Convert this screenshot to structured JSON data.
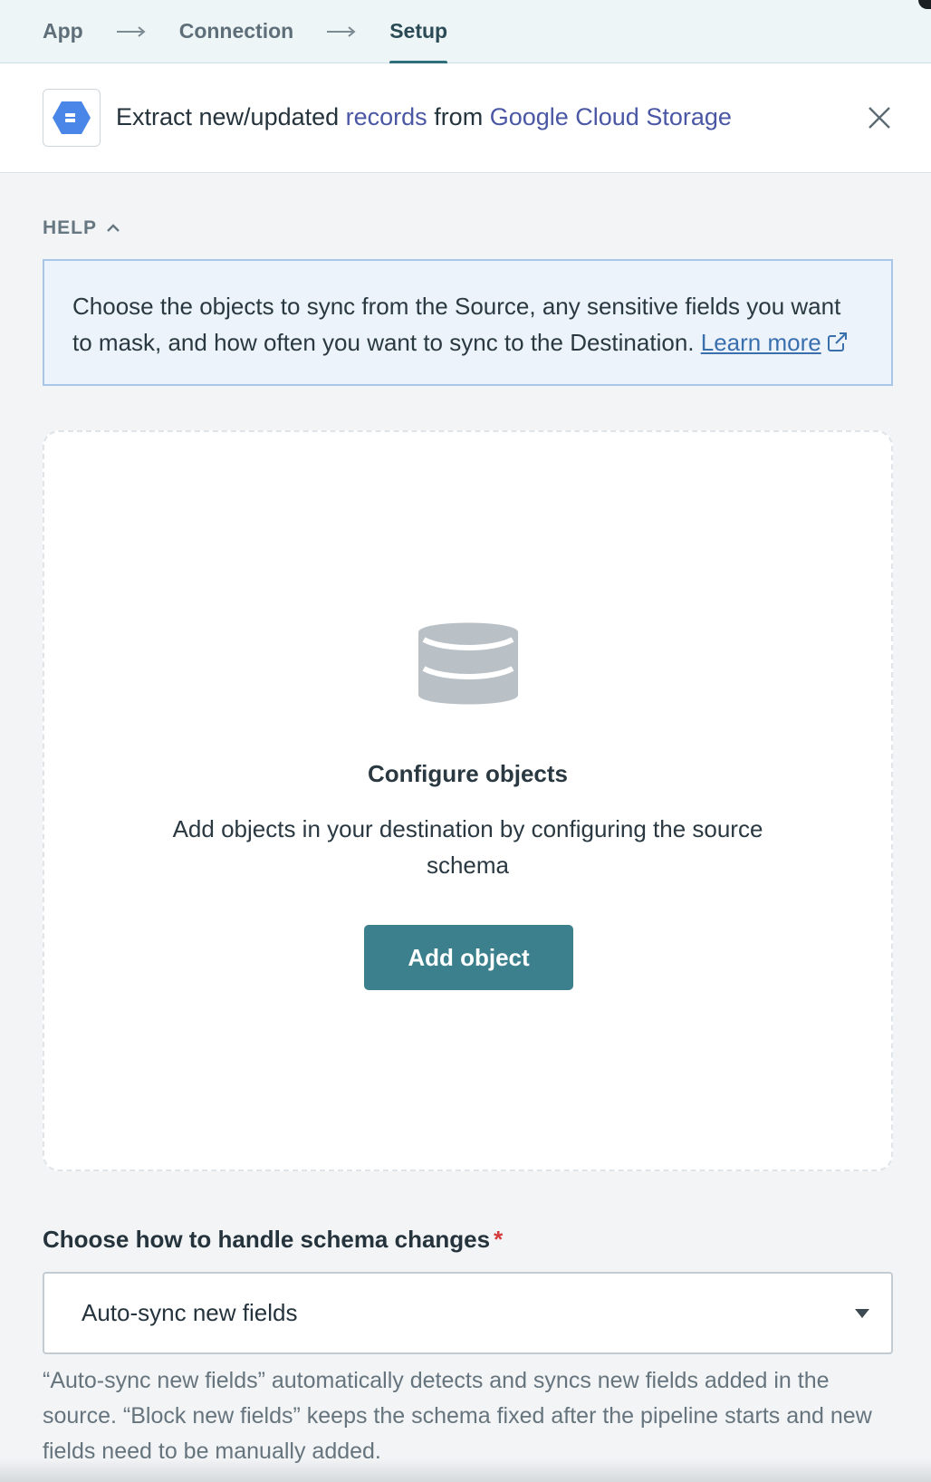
{
  "breadcrumb": {
    "items": [
      {
        "label": "App",
        "active": false
      },
      {
        "label": "Connection",
        "active": false
      },
      {
        "label": "Setup",
        "active": true
      }
    ]
  },
  "header": {
    "title_prefix": "Extract new/updated ",
    "title_object": "records",
    "title_middle": " from ",
    "title_app": "Google Cloud Storage",
    "app_icon": "google-cloud-storage-icon",
    "close_icon": "close-icon"
  },
  "help": {
    "toggle_label": "HELP",
    "text": "Choose the objects to sync from the Source, any sensitive fields you want to mask, and how often you want to sync to the Destination. ",
    "link_label": "Learn more"
  },
  "configure": {
    "icon": "database-icon",
    "title": "Configure objects",
    "description": "Add objects in your destination by configuring the source schema",
    "button_label": "Add object"
  },
  "schema": {
    "label": "Choose how to handle schema changes",
    "required_mark": "*",
    "selected_value": "Auto-sync new fields",
    "help_text": "“Auto-sync new fields” automatically detects and syncs new fields added in the source. “Block new fields” keeps the schema fixed after the pipeline starts and new fields need to be manually added."
  },
  "colors": {
    "accent": "#3b808c",
    "link": "#4a57a4",
    "help_bg": "#ecf3fa",
    "required": "#d53b3b"
  }
}
